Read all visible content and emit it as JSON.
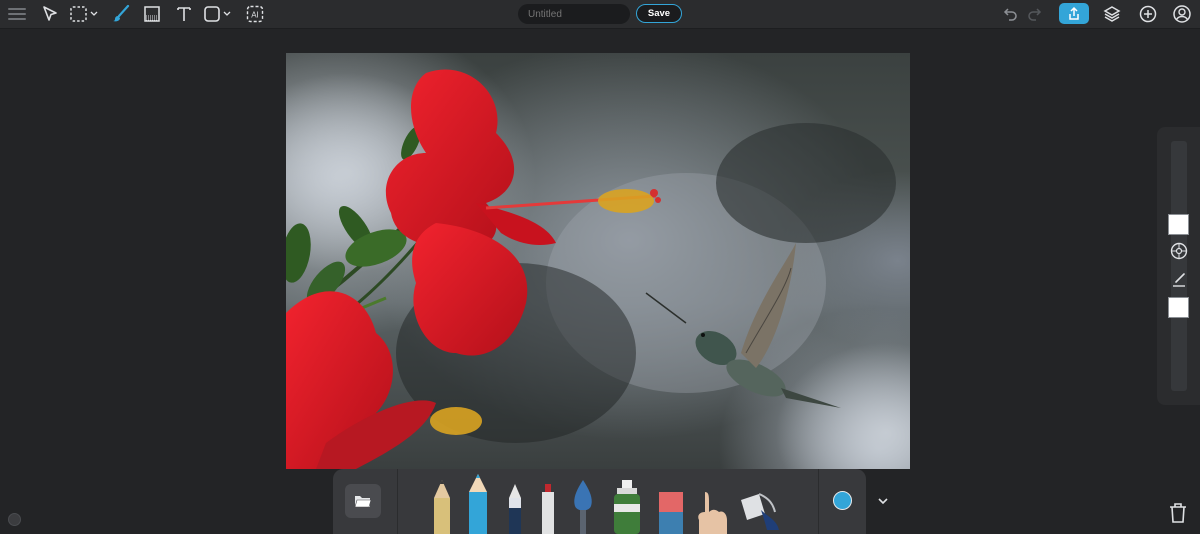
{
  "toolbar": {
    "title_placeholder": "Untitled",
    "save_label": "Save",
    "tools": [
      "menu-icon",
      "select-arrow-icon",
      "marquee-select-icon",
      "brush-icon",
      "texture-icon",
      "text-icon",
      "shape-icon",
      "ai-icon"
    ],
    "right_icons": [
      "undo-icon",
      "redo-icon",
      "export-icon",
      "layers-icon",
      "add-icon",
      "account-icon"
    ]
  },
  "canvas": {
    "image": "hibiscus-and-hummingbird-photo"
  },
  "side_panel": {
    "primary_color": "#ffffff",
    "secondary_color": "#ffffff"
  },
  "bottom_tray": {
    "tools": [
      "open-folder",
      "pencil",
      "colored-pencil",
      "pen",
      "marker",
      "watercolor-brush",
      "spray-can",
      "eraser",
      "smudge-finger",
      "paint-bucket"
    ],
    "active_color": "#33a5d8"
  },
  "colors": {
    "accent": "#33a5d8",
    "background": "#232426",
    "panel": "#2b2c2e"
  }
}
